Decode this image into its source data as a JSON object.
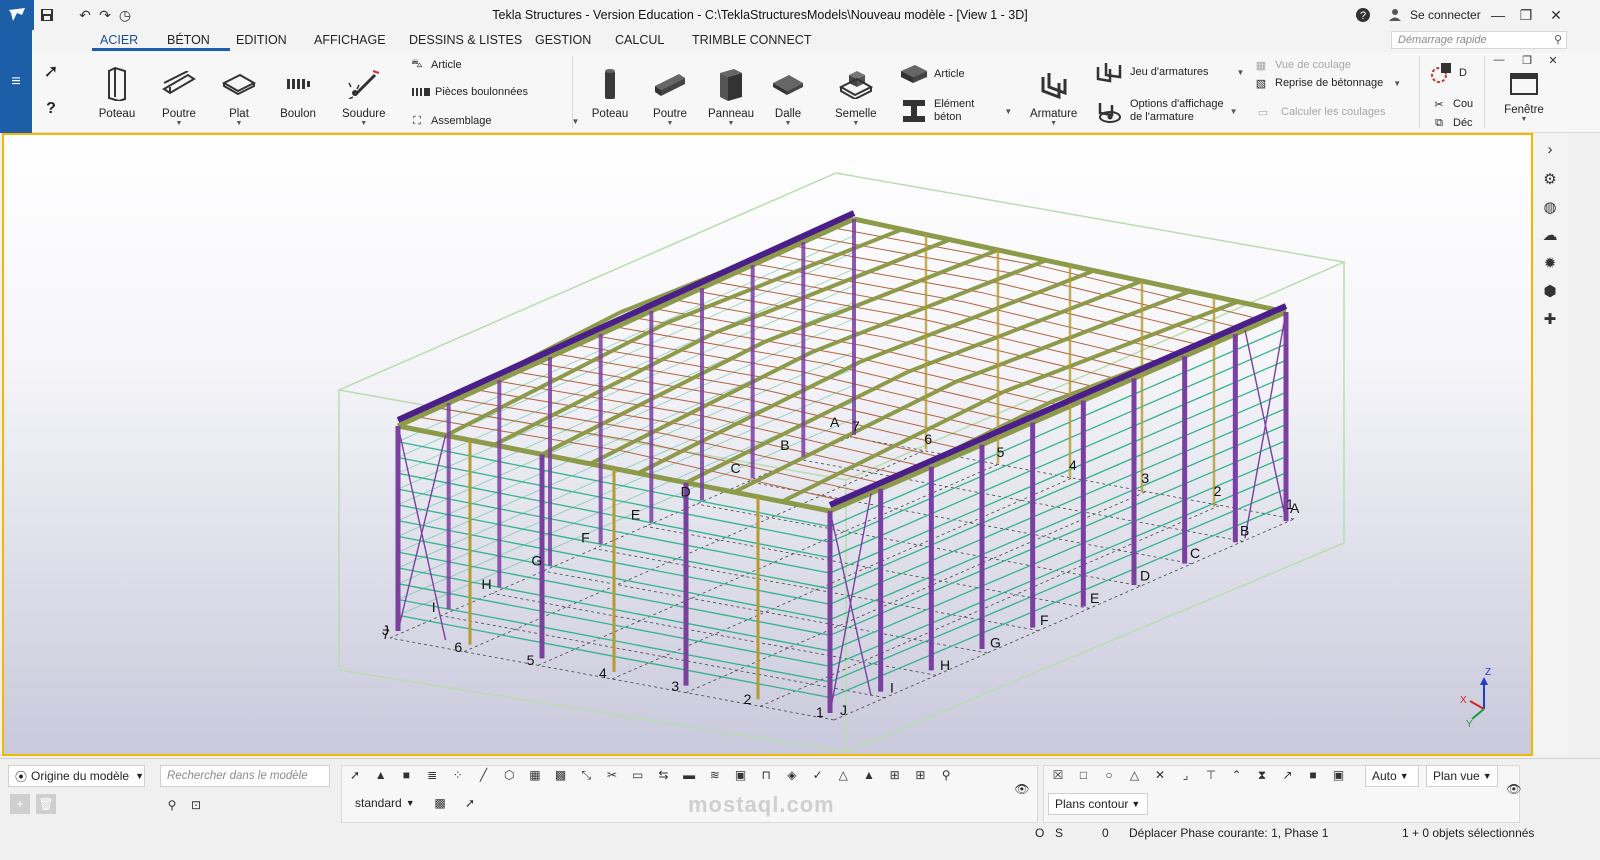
{
  "app": {
    "title": "Tekla Structures - Version Education - C:\\TeklaStructuresModels\\Nouveau modèle - [View 1 - 3D]",
    "login_label": "Se connecter",
    "quick_launch_placeholder": "Démarrage rapide"
  },
  "tabs": [
    {
      "label": "ACIER",
      "active": true
    },
    {
      "label": "BÉTON"
    },
    {
      "label": "EDITION"
    },
    {
      "label": "AFFICHAGE"
    },
    {
      "label": "DESSINS & LISTES"
    },
    {
      "label": "GESTION"
    },
    {
      "label": "CALCUL"
    },
    {
      "label": "TRIMBLE CONNECT"
    }
  ],
  "ribbon": {
    "steel": {
      "poteau": "Poteau",
      "poutre": "Poutre",
      "plat": "Plat",
      "boulon": "Boulon",
      "soudure": "Soudure",
      "article": "Article",
      "pieces_boulonnees": "Pièces boulonnées",
      "assemblage": "Assemblage"
    },
    "concrete": {
      "poteau": "Poteau",
      "poutre": "Poutre",
      "panneau": "Panneau",
      "dalle": "Dalle",
      "semelle": "Semelle",
      "article": "Article",
      "element_beton_1": "Elément",
      "element_beton_2": "béton",
      "armature": "Armature",
      "jeu_armatures": "Jeu d'armatures",
      "options_affichage_1": "Options d'affichage",
      "options_affichage_2": "de l'armature",
      "vue_coulage": "Vue de coulage",
      "reprise_betonnage": "Reprise de bétonnage",
      "calculer_coulages": "Calculer les coulages"
    },
    "misc": {
      "cou": "Cou",
      "dec": "Déc",
      "d": "D",
      "fenetre": "Fenêtre"
    }
  },
  "grid_labels": {
    "letters_front": [
      "A",
      "B",
      "C",
      "D",
      "E",
      "F",
      "G",
      "H",
      "I",
      "J"
    ],
    "numbers_left": [
      "7",
      "6",
      "5",
      "4",
      "3",
      "2",
      "1"
    ],
    "letters_right": [
      "A",
      "B",
      "C",
      "D",
      "E",
      "F",
      "G",
      "H",
      "I",
      "J"
    ],
    "numbers_back": [
      "7",
      "6",
      "5",
      "4",
      "3",
      "2",
      "1"
    ]
  },
  "axis_labels": {
    "z": "Z",
    "x": "X",
    "y": "Y"
  },
  "bottom": {
    "origin_label": "Origine du modèle",
    "search_placeholder": "Rechercher dans le modèle",
    "filter_value": "standard",
    "auto_label": "Auto",
    "plan_vue_label": "Plan vue",
    "plans_contour_label": "Plans contour"
  },
  "status": {
    "o": "O",
    "s": "S",
    "zero": "0",
    "message": "Déplacer Phase courante: 1, Phase 1",
    "selection": "1 + 0 objets sélectionnés"
  },
  "watermark": "mostaql.com",
  "colors": {
    "brand_blue": "#1c5fa8",
    "viewport_border": "#f2b800",
    "column_purple": "#7a3fa0",
    "beam_olive": "#8c9a4a",
    "girt_teal": "#33b38a",
    "purlin_brown": "#b3623a"
  }
}
